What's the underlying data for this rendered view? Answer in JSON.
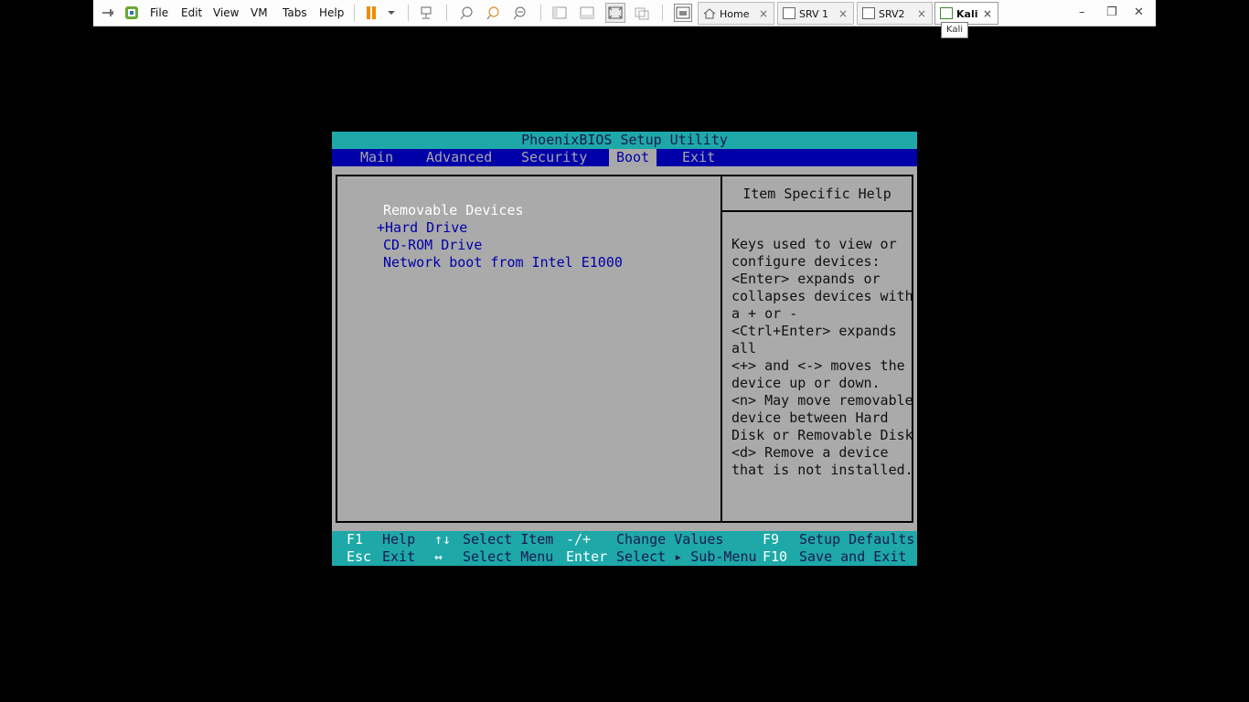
{
  "toolbar": {
    "menus": [
      "File",
      "Edit",
      "View",
      "VM",
      "Tabs",
      "Help"
    ],
    "tabs": [
      {
        "label": "Home",
        "close": "×"
      },
      {
        "label": "SRV 1",
        "close": "×"
      },
      {
        "label": "SRV2",
        "close": "×"
      },
      {
        "label": "Kali",
        "close": "×"
      }
    ],
    "tooltip": "Kali",
    "window_controls": {
      "minimize": "–",
      "restore": "❐",
      "close": "✕"
    }
  },
  "bios": {
    "title": "PhoenixBIOS Setup Utility",
    "menu": [
      "Main",
      "Advanced",
      "Security",
      "Boot",
      "Exit"
    ],
    "selected_menu": "Boot",
    "boot_items": [
      "Removable Devices",
      "+Hard Drive",
      "CD-ROM Drive",
      "Network boot from Intel E1000"
    ],
    "help_title": "Item Specific Help",
    "help_lines": [
      "Keys used to view or",
      "configure devices:",
      "<Enter> expands or",
      "collapses devices with",
      "a + or -",
      "<Ctrl+Enter> expands",
      "all",
      "<+> and <-> moves the",
      "device up or down.",
      "<n> May move removable",
      "device between Hard",
      "Disk or Removable Disk",
      "<d> Remove a device",
      "that is not installed."
    ],
    "footer": {
      "row1": [
        {
          "key": "F1",
          "desc": "Help"
        },
        {
          "key": "↑↓",
          "desc": "Select Item"
        },
        {
          "key": "-/+",
          "desc": "Change Values"
        },
        {
          "key": "F9",
          "desc": "Setup Defaults"
        }
      ],
      "row2": [
        {
          "key": "Esc",
          "desc": "Exit"
        },
        {
          "key": "↔",
          "desc": "Select Menu"
        },
        {
          "key": "Enter",
          "desc": "Select ▸ Sub-Menu"
        },
        {
          "key": "F10",
          "desc": "Save and Exit"
        }
      ]
    }
  }
}
